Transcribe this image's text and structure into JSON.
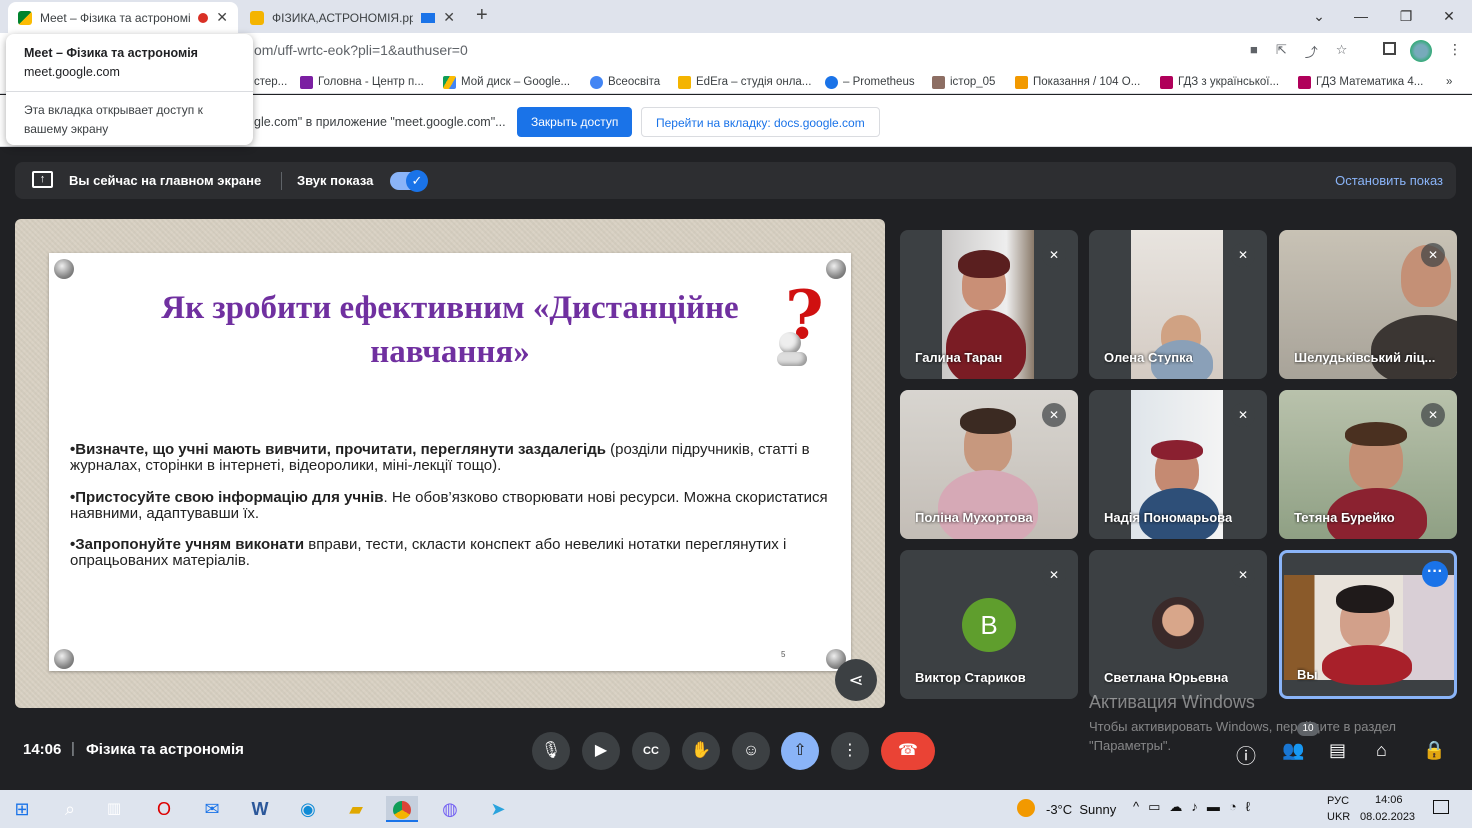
{
  "browser": {
    "tabs": [
      {
        "title": "Meet – Фізика та астрономі",
        "active": true
      },
      {
        "title": "ФІЗИКА,АСТРОНОМІЯ.pptx",
        "active": false
      }
    ],
    "new_tab": "+",
    "url": "om/uff-wrtc-eok?pli=1&authuser=0",
    "bookmarks": [
      "стер...",
      "Головна - Центр п...",
      "Мой диск – Google...",
      "Всеосвіта",
      "EdEra – студія онла...",
      "– Prometheus",
      "істор_05",
      "Показання / 104 О...",
      "ГДЗ з української...",
      "ГДЗ Математика 4..."
    ],
    "bookmarks_more": "»",
    "infobar": {
      "text": "gle.com\" в приложение \"meet.google.com\"...",
      "stop_button": "Закрыть доступ",
      "switch_button": "Перейти на вкладку: docs.google.com"
    },
    "popup": {
      "title": "Meet – Фізика та астрономія",
      "domain": "meet.google.com",
      "note": "Эта вкладка открывает доступ к вашему экрану"
    }
  },
  "meet": {
    "share": {
      "status": "Вы сейчас на главном экране",
      "audio_label": "Звук показа",
      "stop": "Остановить показ"
    },
    "slide": {
      "title_line1": "Як зробити ефективним «Дистанційне",
      "title_line2": "навчання»",
      "bullets": [
        {
          "bold": "•Визначте, що учні мають вивчити, прочитати, переглянути заздалегідь",
          "rest": " (розділи підручників, статті в журналах, сторінки в інтернеті, відеоролики, міні-лекції тощо)."
        },
        {
          "bold": "•Пристосуйте свою інформацію для учнів",
          "rest": ". Не обов’язково створювати нові ресурси. Можна скористатися наявними, адаптувавши їх."
        },
        {
          "bold": "•Запропонуйте учням виконати",
          "rest": " вправи, тести, скласти конспект або невеликі нотатки переглянутих і опрацьованих матеріалів."
        }
      ],
      "page_number": "5"
    },
    "participants": [
      {
        "name": "Галина Таран",
        "muted": true
      },
      {
        "name": "Олена Ступка",
        "muted": true
      },
      {
        "name": "Шелудьківський ліц...",
        "muted": true
      },
      {
        "name": "Поліна Мухортова",
        "muted": true
      },
      {
        "name": "Надія Пономарьова",
        "muted": true
      },
      {
        "name": "Тетяна Бурейко",
        "muted": true
      },
      {
        "name": "Виктор Стариков",
        "muted": true,
        "avatar_letter": "В",
        "avatar_color": "#5f9e2d"
      },
      {
        "name": "Светлана Юрьевна",
        "muted": true
      },
      {
        "name": "Вы",
        "muted": false
      }
    ],
    "time": "14:06",
    "separator": "|",
    "meeting_title": "Фізика та астрономія",
    "participants_count": "10",
    "watermark": {
      "title": "Активация Windows",
      "text": "Чтобы активировать Windows, перейдите в раздел \"Параметры\"."
    }
  },
  "taskbar": {
    "weather": "-3°C  Sunny",
    "lang_top": "РУС",
    "lang_bottom": "UKR",
    "clock_time": "14:06",
    "clock_date": "08.02.2023"
  },
  "colors": {
    "accent": "#1a73e8",
    "meet_bg": "#202124",
    "end_call": "#ea4335",
    "slide_title": "#7030a0"
  }
}
